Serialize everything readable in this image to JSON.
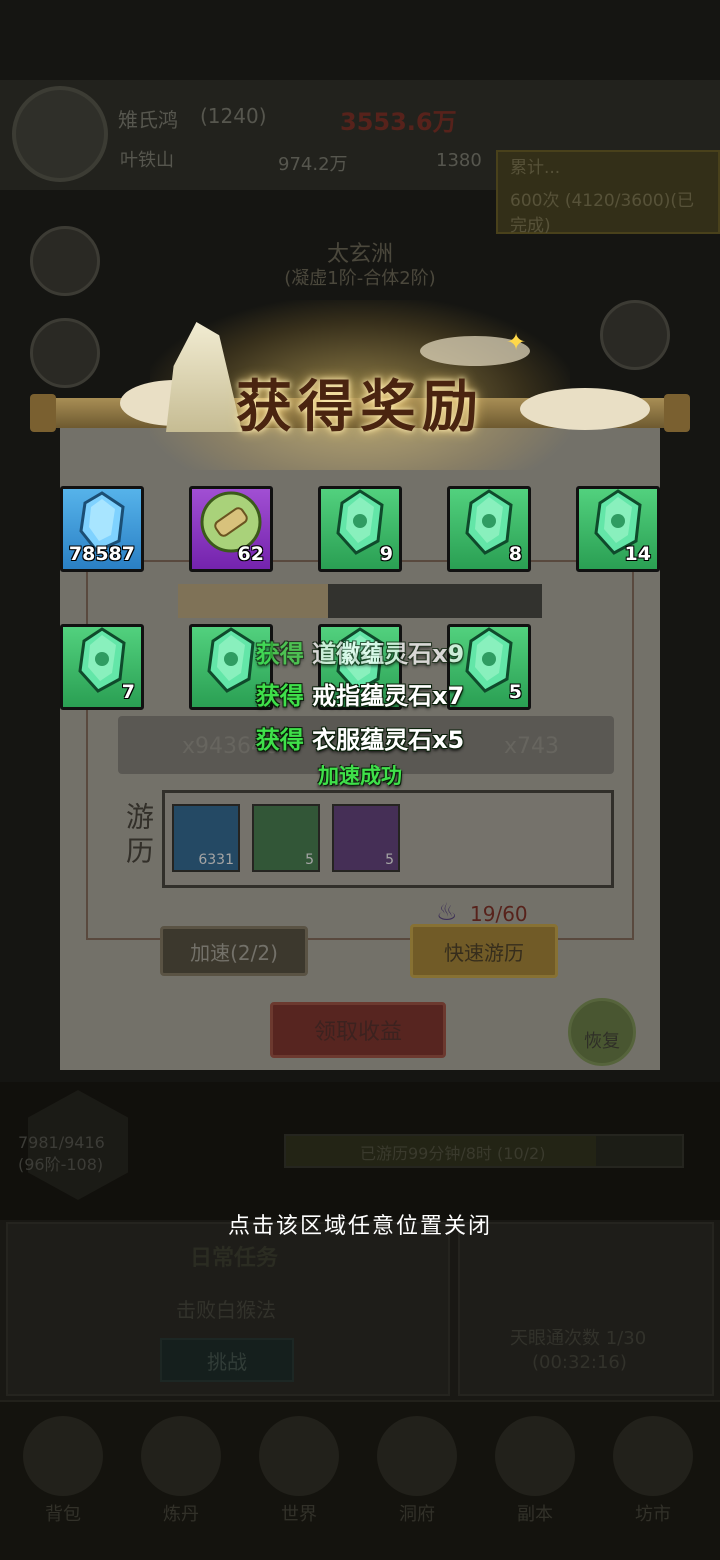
{
  "background": {
    "player_name": "雉氏鸿",
    "player_level": "(1240)",
    "power": "3553.6万",
    "sect_name": "叶铁山",
    "stone_count": "974.2万",
    "coin_count": "1380",
    "event_text_1": "累计...",
    "event_text_2": "600次 (4120/3600)(已完成)",
    "region_name": "太玄洲",
    "region_sub": "(凝虚1阶-合体2阶)",
    "res_left": "x943648",
    "res_right": "x743",
    "travel_label": "游历",
    "travel_items": [
      {
        "count": "6331",
        "color": "blue"
      },
      {
        "count": "5",
        "color": "green"
      },
      {
        "count": "5",
        "color": "purple"
      }
    ],
    "energy": "19/60",
    "speed_button": "加速(2/2)",
    "fast_button": "快速游历",
    "collect_button": "领取收益",
    "restore_button": "恢复",
    "level_text_1": "7981/9416",
    "level_text_2": "(96阶-108)",
    "travel_bar_text": "已游历99分钟/8时 (10/2)",
    "card_title": "日常任务",
    "card_sub": "击败白猴法",
    "card_button": "挑战",
    "card_right_1": "天眼通次数 1/30",
    "card_right_2": "(00:32:16)",
    "nav_items": [
      "背包",
      "炼丹",
      "世界",
      "洞府",
      "副本",
      "坊市"
    ]
  },
  "modal": {
    "title": "获得奖励",
    "rewards": [
      {
        "count": "78587",
        "color": "blue",
        "icon": "spirit-stone-icon"
      },
      {
        "count": "62",
        "color": "purple",
        "icon": "scroll-icon"
      },
      {
        "count": "9",
        "color": "green",
        "icon": "jade-stone-icon"
      },
      {
        "count": "8",
        "color": "green",
        "icon": "jade-stone-icon"
      },
      {
        "count": "14",
        "color": "green",
        "icon": "jade-stone-icon"
      },
      {
        "count": "7",
        "color": "green",
        "icon": "jade-stone-icon"
      },
      {
        "count": "",
        "color": "green",
        "icon": "jade-stone-icon"
      },
      {
        "count": "",
        "color": "green",
        "icon": "jade-stone-icon"
      },
      {
        "count": "5",
        "color": "green",
        "icon": "jade-stone-icon"
      }
    ],
    "toasts": [
      {
        "prefix": "获得",
        "text": "道徽蕴灵石x9"
      },
      {
        "prefix": "获得",
        "text": "戒指蕴灵石x7"
      },
      {
        "prefix": "获得",
        "text": "衣服蕴灵石x5"
      }
    ],
    "success_text": "加速成功",
    "close_hint": "点击该区域任意位置关闭"
  },
  "colors": {
    "reward_blue": "#2a7fc4",
    "reward_purple": "#7423ad",
    "reward_green": "#2a9f53",
    "toast_green": "#3fe04a",
    "title_brown": "#4a2410"
  }
}
